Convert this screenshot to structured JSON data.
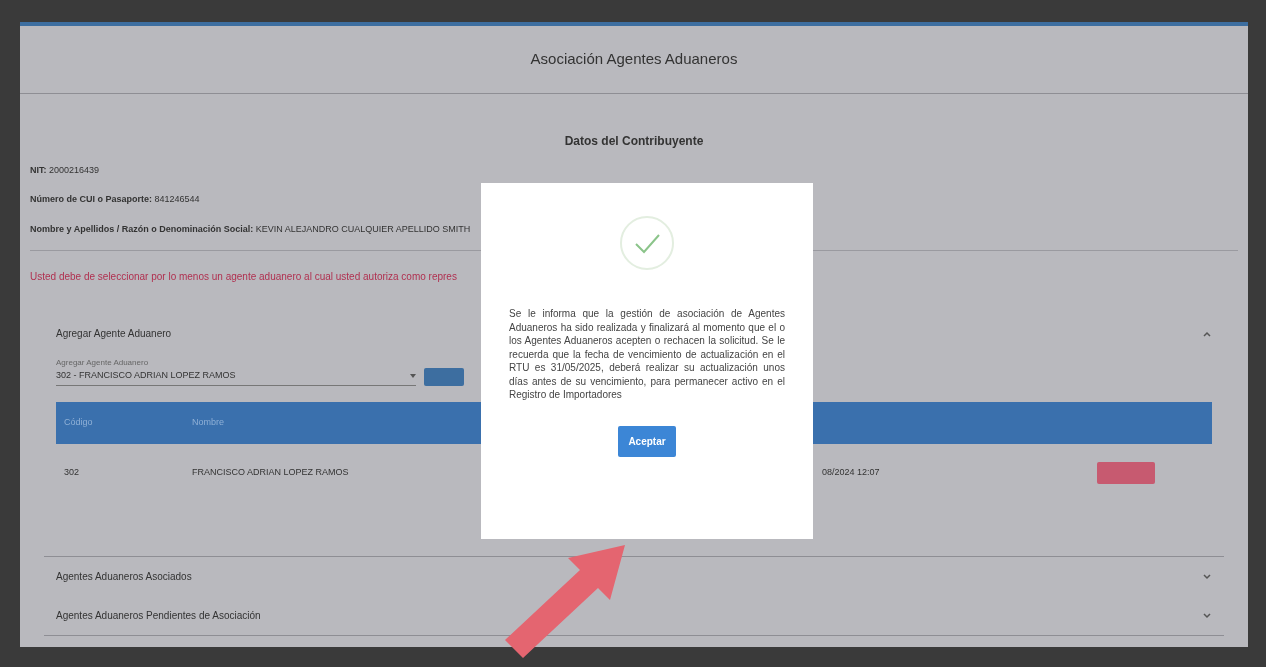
{
  "header": {
    "title": "Asociación Agentes Aduaneros"
  },
  "taxpayer": {
    "title": "Datos del Contribuyente",
    "fields": [
      {
        "label": "NIT:",
        "value": "2000216439"
      },
      {
        "label": "Número de CUI o Pasaporte:",
        "value": "841246544"
      },
      {
        "label": "Nombre y Apellidos / Razón o Denominación Social:",
        "value": "KEVIN ALEJANDRO CUALQUIER APELLIDO SMITH"
      }
    ]
  },
  "warning": "Usted debe de seleccionar por lo menos un agente aduanero al cual usted autoriza como repres",
  "sections": [
    {
      "title": "Agregar Agente Aduanero",
      "expanded": true,
      "select": {
        "label": "Agregar Agente Aduanero",
        "value": "302 - FRANCISCO ADRIAN LOPEZ RAMOS"
      },
      "table": {
        "columns": [
          "Código",
          "Nombre"
        ],
        "rows": [
          {
            "code": "302",
            "name": "FRANCISCO ADRIAN LOPEZ RAMOS",
            "date": "08/2024 12:07"
          }
        ]
      }
    },
    {
      "title": "Agentes Aduaneros Asociados",
      "expanded": false
    },
    {
      "title": "Agentes Aduaneros Pendientes de Asociación",
      "expanded": false
    }
  ],
  "dialog": {
    "message": "Se le informa que la gestión de asociación de Agentes Aduaneros ha sido realizada y finalizará al momento que el o los Agentes Aduaneros acepten o rechacen la solicitud. Se le recuerda que la fecha de vencimiento de actualización en el RTU es 31/05/2025, deberá realizar su actualización unos días antes de su vencimiento, para permanecer activo en el Registro de Importadores",
    "button": "Aceptar"
  }
}
